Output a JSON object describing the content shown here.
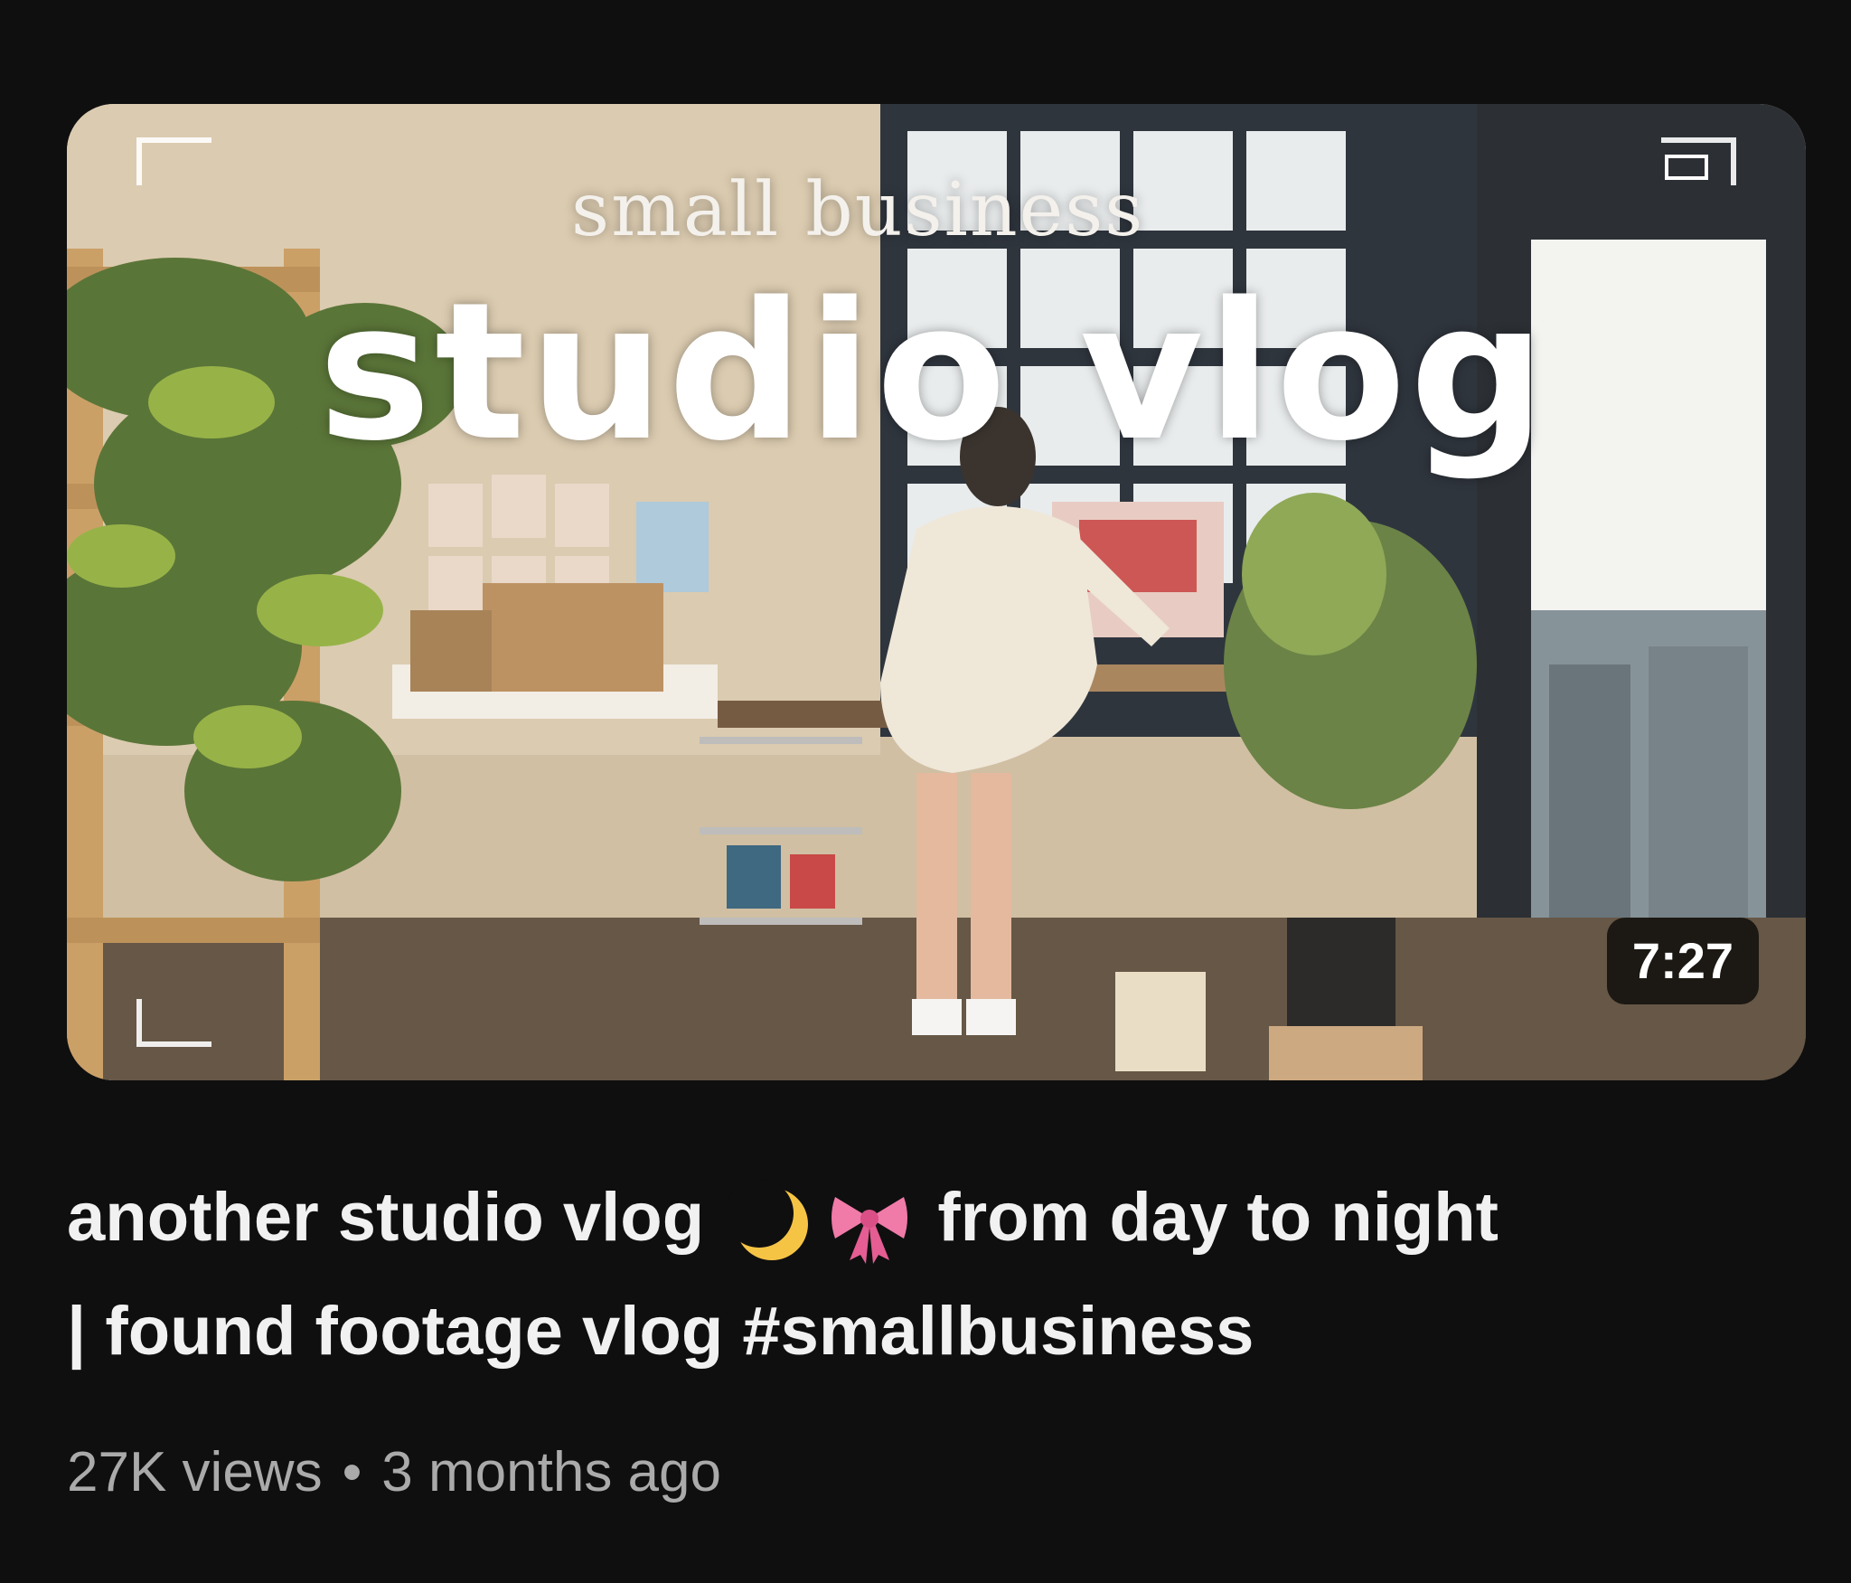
{
  "video": {
    "thumbnail": {
      "overlay_subtitle": "small business",
      "overlay_title": "studio vlog",
      "duration": "7:27"
    },
    "title_part1": "another studio vlog",
    "title_emoji_1": "crescent-moon-icon",
    "title_emoji_2": "pink-ribbon-icon",
    "title_part2": "from day to night",
    "title_part3": "| found footage vlog #smallbusiness",
    "views": "27K views",
    "separator": "•",
    "age": "3 months ago"
  },
  "colors": {
    "background": "#0f0f0f",
    "title_text": "#f1f1f1",
    "meta_text": "#aaaaaa",
    "duration_bg": "#000000"
  }
}
